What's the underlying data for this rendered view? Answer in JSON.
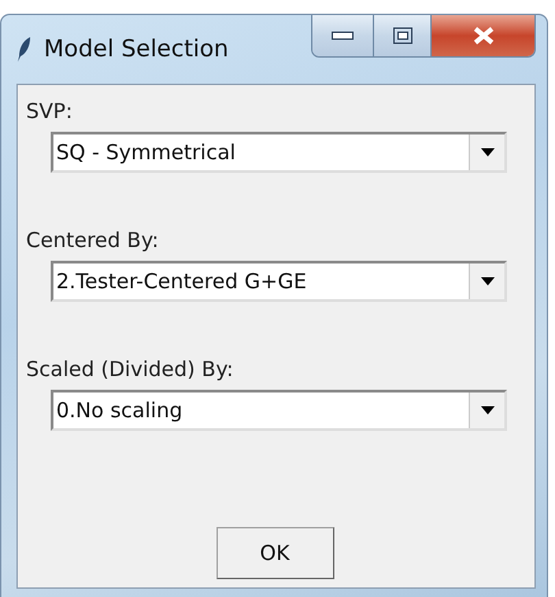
{
  "window": {
    "title": "Model Selection"
  },
  "fields": [
    {
      "label": "SVP:",
      "value": "SQ - Symmetrical"
    },
    {
      "label": "Centered By:",
      "value": "2.Tester-Centered G+GE"
    },
    {
      "label": "Scaled (Divided) By:",
      "value": "0.No scaling"
    }
  ],
  "buttons": [
    "OK"
  ]
}
